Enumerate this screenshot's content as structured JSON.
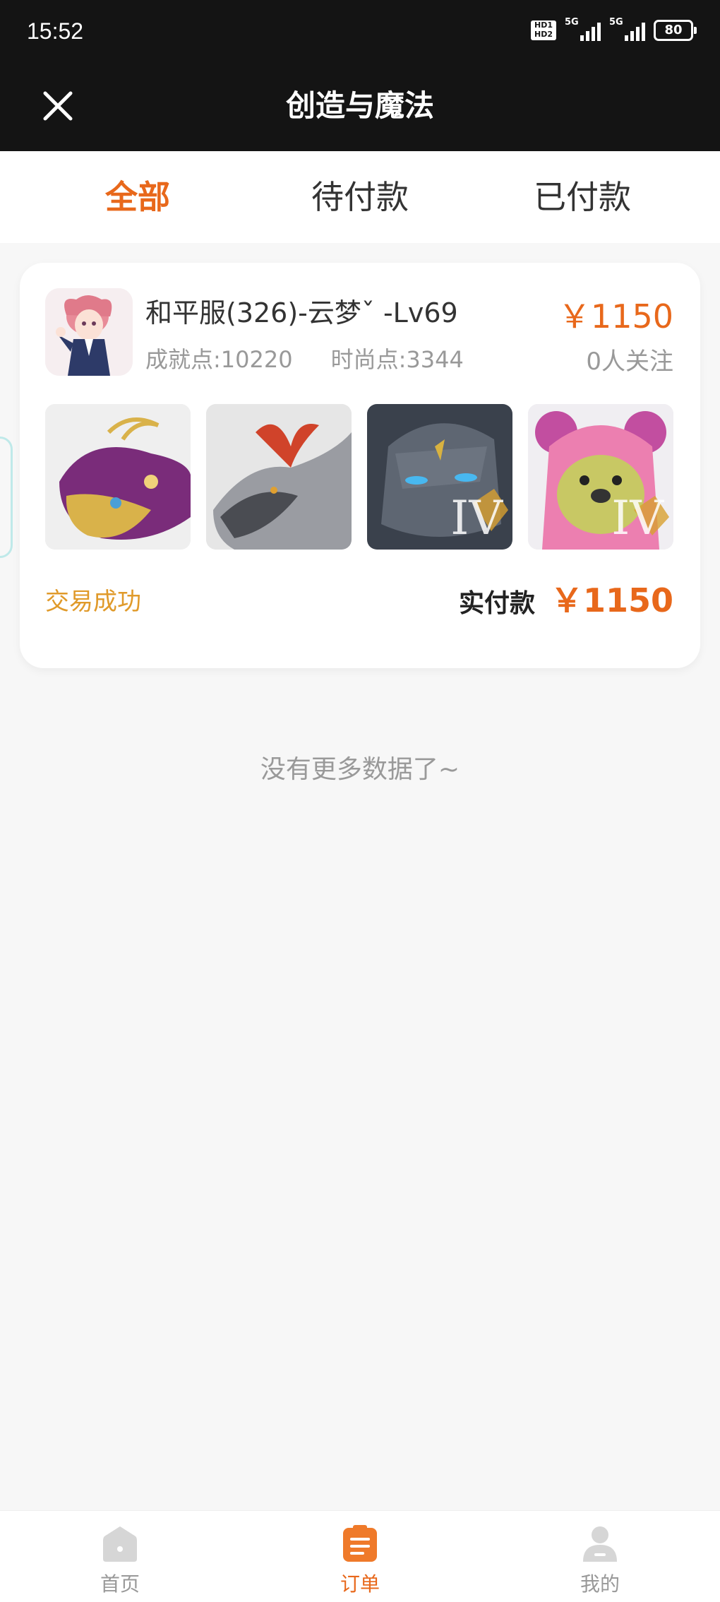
{
  "status_bar": {
    "time": "15:52",
    "signal1_label": "5G",
    "signal2_label": "5G",
    "battery": "80"
  },
  "header": {
    "title": "创造与魔法",
    "close_icon": "close-icon"
  },
  "tabs": [
    {
      "label": "全部",
      "active": true
    },
    {
      "label": "待付款",
      "active": false
    },
    {
      "label": "已付款",
      "active": false
    }
  ],
  "order": {
    "title": "和平服(326)-云梦ˇ  -Lv69",
    "achievement": "成就点:10220",
    "fashion": "时尚点:3344",
    "price": "￥1150",
    "followers": "0人关注",
    "items": [
      {
        "name": "golden-fish-mount",
        "tier": ""
      },
      {
        "name": "dragon-mount",
        "tier": ""
      },
      {
        "name": "stone-golem-mount",
        "tier": "IV"
      },
      {
        "name": "pink-bear-mount",
        "tier": "IV"
      }
    ],
    "status": "交易成功",
    "paid_label": "实付款",
    "paid_amount": "￥1150"
  },
  "footer_text": "没有更多数据了~",
  "tabbar": [
    {
      "label": "首页",
      "icon": "home-icon",
      "active": false
    },
    {
      "label": "订单",
      "icon": "order-icon",
      "active": true
    },
    {
      "label": "我的",
      "icon": "profile-icon",
      "active": false
    }
  ],
  "colors": {
    "accent": "#e8681b",
    "status": "#e09a2a",
    "header_bg": "#141414"
  }
}
